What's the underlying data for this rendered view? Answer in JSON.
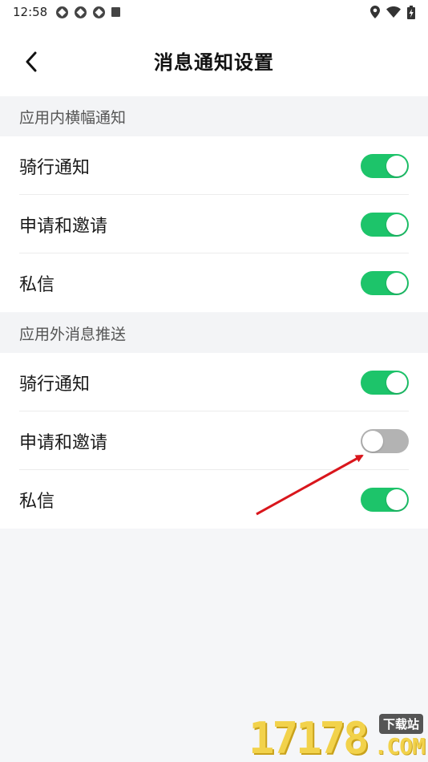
{
  "status_bar": {
    "time": "12:58"
  },
  "header": {
    "title": "消息通知设置"
  },
  "sections": [
    {
      "title": "应用内横幅通知",
      "items": [
        {
          "label": "骑行通知",
          "enabled": true
        },
        {
          "label": "申请和邀请",
          "enabled": true
        },
        {
          "label": "私信",
          "enabled": true
        }
      ]
    },
    {
      "title": "应用外消息推送",
      "items": [
        {
          "label": "骑行通知",
          "enabled": true
        },
        {
          "label": "申请和邀请",
          "enabled": false
        },
        {
          "label": "私信",
          "enabled": true
        }
      ]
    }
  ],
  "colors": {
    "toggle_on": "#1dc46a",
    "toggle_off": "#b3b3b3",
    "annotation_arrow": "#d9161c"
  },
  "watermark": {
    "digits": "17178",
    "tag": "下载站",
    "suffix": ".COM"
  }
}
